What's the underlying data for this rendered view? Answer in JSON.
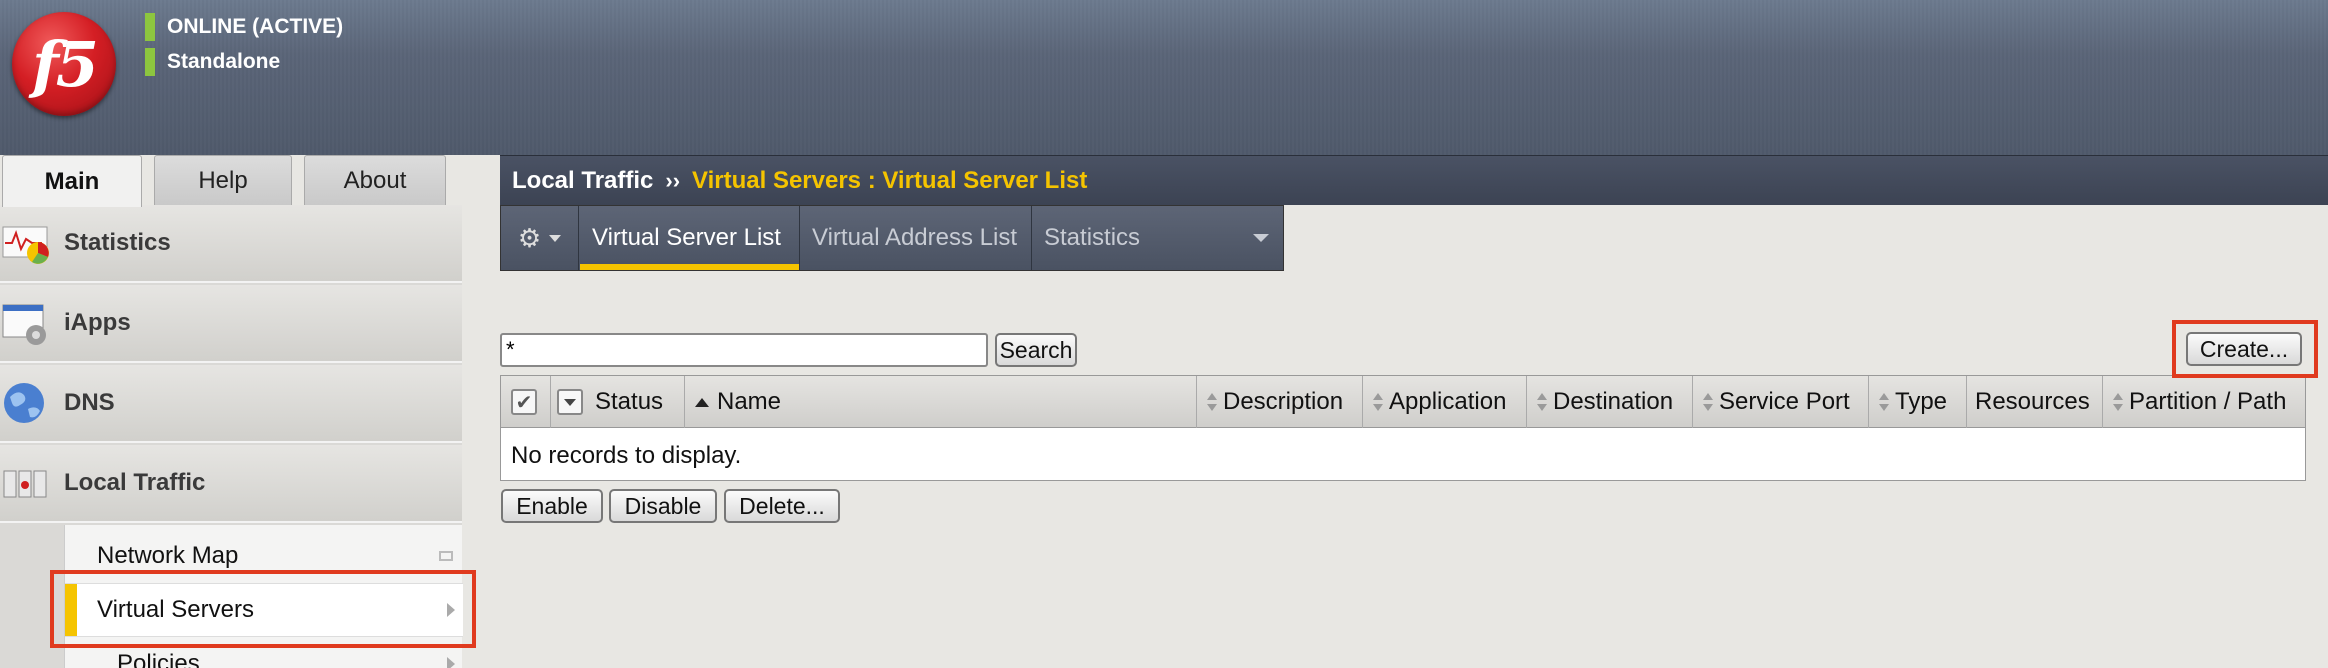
{
  "header": {
    "logo_text": "f5",
    "status_primary": "ONLINE (ACTIVE)",
    "status_secondary": "Standalone",
    "status_color": "#8dc63f"
  },
  "top_tabs": [
    {
      "label": "Main",
      "active": true
    },
    {
      "label": "Help",
      "active": false
    },
    {
      "label": "About",
      "active": false
    }
  ],
  "sidebar": {
    "items": [
      {
        "label": "Statistics",
        "icon": "statistics-icon"
      },
      {
        "label": "iApps",
        "icon": "iapps-icon"
      },
      {
        "label": "DNS",
        "icon": "dns-globe-icon"
      },
      {
        "label": "Local Traffic",
        "icon": "local-traffic-icon"
      }
    ],
    "sub_items": [
      {
        "label": "Network Map",
        "selected": false
      },
      {
        "label": "Virtual Servers",
        "selected": true
      },
      {
        "label": "Policies",
        "selected": false
      }
    ]
  },
  "breadcrumb": {
    "section": "Local Traffic",
    "separator": "››",
    "page": "Virtual Servers : Virtual Server List"
  },
  "sub_tabs": {
    "gear_icon": "gear-icon",
    "items": [
      {
        "label": "Virtual Server List",
        "active": true
      },
      {
        "label": "Virtual Address List",
        "active": false
      },
      {
        "label": "Statistics",
        "active": false,
        "dropdown": true
      }
    ]
  },
  "search": {
    "value": "*",
    "button_label": "Search"
  },
  "create_button_label": "Create...",
  "table": {
    "columns": [
      "Status",
      "Name",
      "Description",
      "Application",
      "Destination",
      "Service Port",
      "Type",
      "Resources",
      "Partition / Path"
    ],
    "empty_message": "No records to display."
  },
  "actions": {
    "enable": "Enable",
    "disable": "Disable",
    "delete": "Delete..."
  },
  "colors": {
    "accent": "#f5c400",
    "highlight": "#e03a1e"
  }
}
